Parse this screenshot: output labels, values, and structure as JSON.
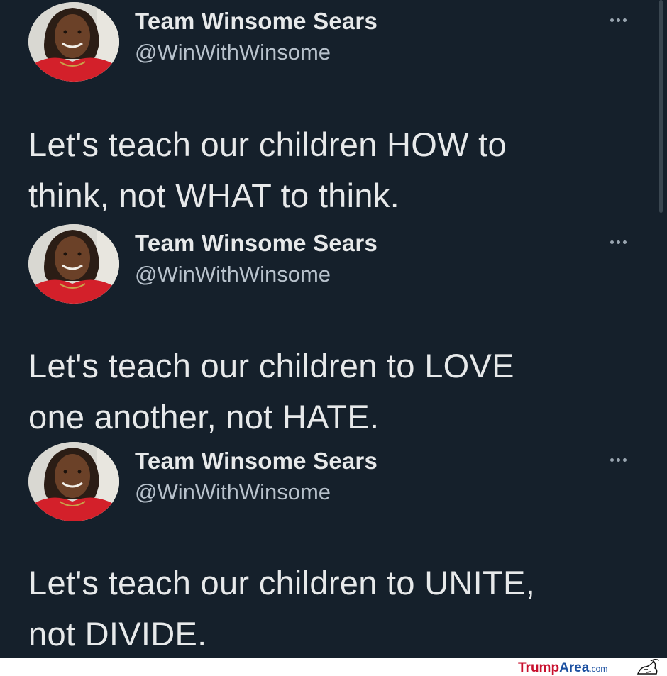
{
  "tweets": [
    {
      "author_name": "Team Winsome Sears",
      "author_handle": "@WinWithWinsome",
      "text_line1": "Let's teach our children HOW to",
      "text_line2": "think, not WHAT to think."
    },
    {
      "author_name": "Team Winsome Sears",
      "author_handle": "@WinWithWinsome",
      "text_line1": "Let's teach our children to LOVE",
      "text_line2": "one another, not HATE."
    },
    {
      "author_name": "Team Winsome Sears",
      "author_handle": "@WinWithWinsome",
      "text_line1": "Let's teach our children to UNITE,",
      "text_line2": "not DIVIDE."
    }
  ],
  "icons": {
    "more": "more-options-icon",
    "avatar": "profile-avatar"
  },
  "watermark": {
    "part1": "Trump",
    "part2": "Area",
    "part3": ".com"
  },
  "colors": {
    "background": "#15202b",
    "text": "#e7e9ea",
    "secondary": "#b8c2cc",
    "watermark_red": "#c8102e",
    "watermark_blue": "#1a4fa0"
  }
}
